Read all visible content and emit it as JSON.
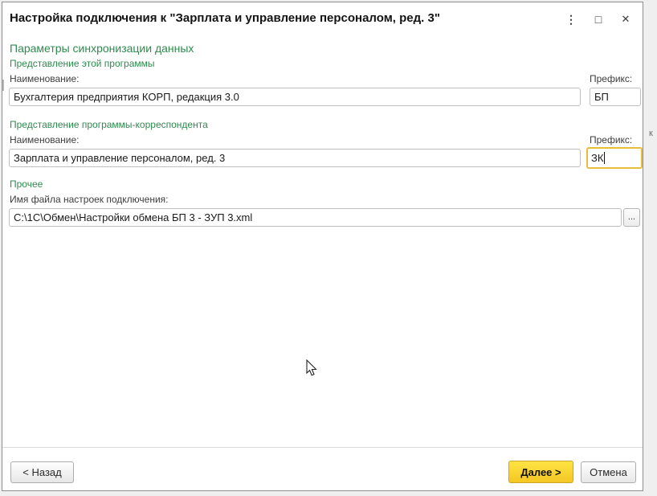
{
  "window": {
    "title": "Настройка подключения к \"Зарплата и управление персоналом, ред. 3\"",
    "controls": {
      "more_glyph": "⋮",
      "maximize_glyph": "□",
      "close_glyph": "✕"
    }
  },
  "colors": {
    "heading_green": "#2e8b4e",
    "focus_border_yellow": "#e7bd39",
    "next_button_yellow": "#f9d431"
  },
  "page_heading": "Параметры синхронизации данных",
  "sections": {
    "this_app": {
      "heading": "Представление этой программы",
      "name_label": "Наименование:",
      "name_value": "Бухгалтерия предприятия КОРП, редакция 3.0",
      "prefix_label": "Префикс:",
      "prefix_value": "БП"
    },
    "correspondent_app": {
      "heading": "Представление программы-корреспондента",
      "name_label": "Наименование:",
      "name_value": "Зарплата и управление персоналом, ред. 3",
      "prefix_label": "Префикс:",
      "prefix_value": "ЗК"
    },
    "other": {
      "heading": "Прочее",
      "file_label": "Имя файла настроек подключения:",
      "file_value": "C:\\1C\\Обмен\\Настройки обмена БП 3 - ЗУП 3.xml",
      "browse_label": "..."
    }
  },
  "footer": {
    "back_label": "< Назад",
    "next_label": "Далее >",
    "cancel_label": "Отмена"
  },
  "background_fragment": "к"
}
